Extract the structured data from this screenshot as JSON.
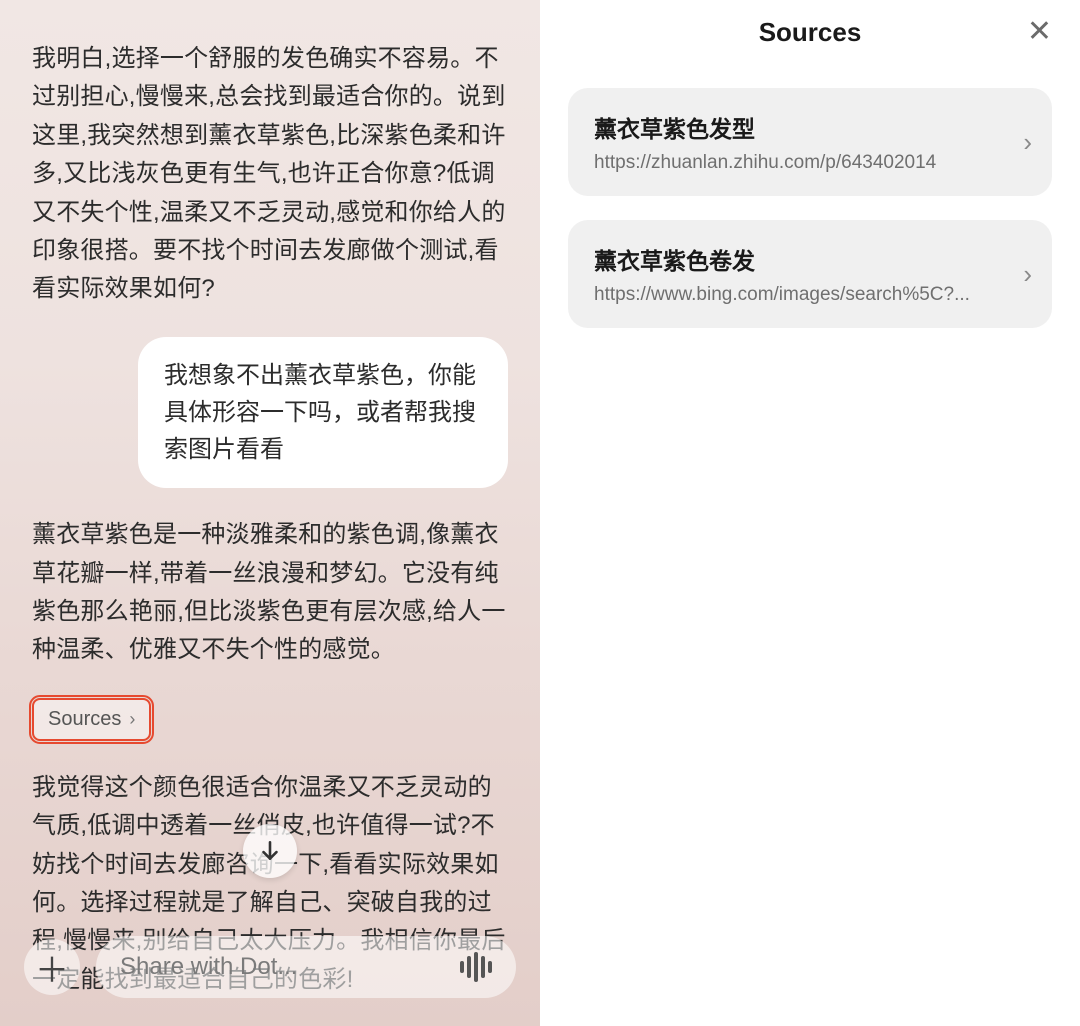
{
  "chat": {
    "ai_msg_1": "我明白,选择一个舒服的发色确实不容易。不过别担心,慢慢来,总会找到最适合你的。说到这里,我突然想到薰衣草紫色,比深紫色柔和许多,又比浅灰色更有生气,也许正合你意?低调又不失个性,温柔又不乏灵动,感觉和你给人的印象很搭。要不找个时间去发廊做个测试,看看实际效果如何?",
    "user_msg_1": "我想象不出薰衣草紫色，你能具体形容一下吗，或者帮我搜索图片看看",
    "ai_msg_2": "薰衣草紫色是一种淡雅柔和的紫色调,像薰衣草花瓣一样,带着一丝浪漫和梦幻。它没有纯紫色那么艳丽,但比淡紫色更有层次感,给人一种温柔、优雅又不失个性的感觉。",
    "sources_button": "Sources",
    "ai_msg_3": "我觉得这个颜色很适合你温柔又不乏灵动的气质,低调中透着一丝俏皮,也许值得一试?不妨找个时间去发廊咨询一下,看看实际效果如何。选择过程就是了解自己、突破自我的过程,慢慢来,别给自己太大压力。我相信你最后一定能找到最适合自己的色彩!",
    "input_placeholder": "Share with Dot..."
  },
  "sources_panel": {
    "title": "Sources",
    "items": [
      {
        "title": "薰衣草紫色发型",
        "url": "https://zhuanlan.zhihu.com/p/643402014"
      },
      {
        "title": "薰衣草紫色卷发",
        "url": "https://www.bing.com/images/search%5C?..."
      }
    ]
  }
}
